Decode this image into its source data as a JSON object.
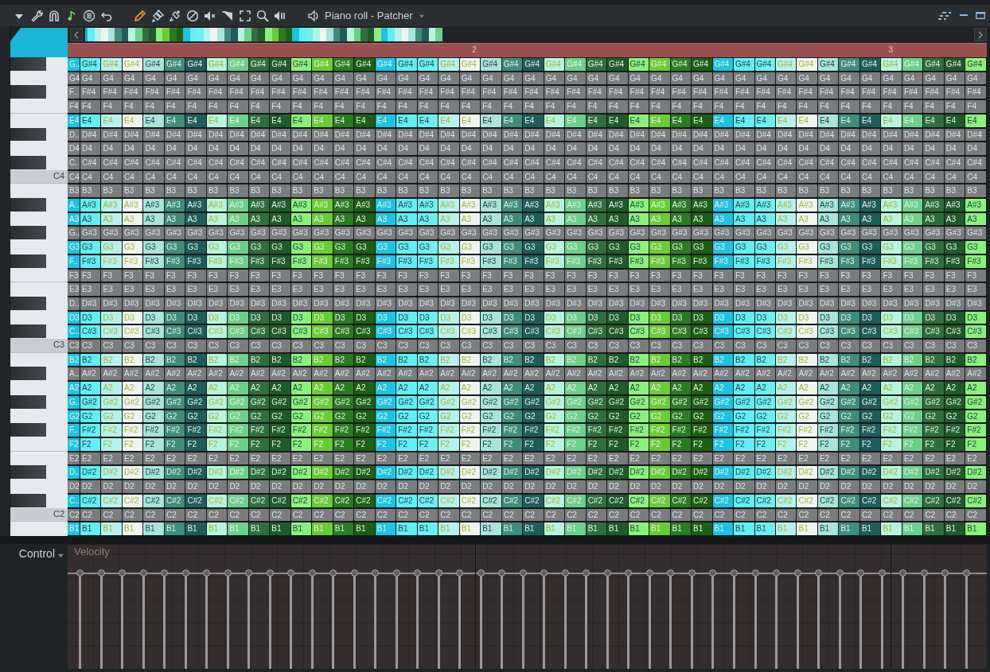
{
  "window": {
    "title": "Piano roll - Patcher"
  },
  "timeline": {
    "markers": [
      {
        "label": "2"
      },
      {
        "label": "3"
      }
    ]
  },
  "columns": [
    {
      "color": "#1cc3e3"
    },
    {
      "color": "#62eef5"
    },
    {
      "color": "#b5f2ee"
    },
    {
      "color": "#eef5f0"
    },
    {
      "color": "#a9e3dc"
    },
    {
      "color": "#3f8c7c"
    },
    {
      "color": "#1f5c5c"
    },
    {
      "color": "#b6f4dd"
    },
    {
      "color": "#6dcf8c"
    },
    {
      "color": "#2f6f3d"
    },
    {
      "color": "#1f5a2b"
    },
    {
      "color": "#8cf07c"
    },
    {
      "color": "#6acc34"
    },
    {
      "color": "#2b7b23"
    },
    {
      "color": "#1d5f15"
    },
    {
      "color": "#1cc3e3"
    },
    {
      "color": "#62eef5"
    },
    {
      "color": "#6ef0f2"
    },
    {
      "color": "#b5f2ee"
    },
    {
      "color": "#eef5f0"
    },
    {
      "color": "#a9e3dc"
    },
    {
      "color": "#3f8c7c"
    },
    {
      "color": "#1f5c5c"
    },
    {
      "color": "#b6f4dd"
    },
    {
      "color": "#6dcf8c"
    },
    {
      "color": "#2f6f3d"
    },
    {
      "color": "#1f5a2b"
    },
    {
      "color": "#8cf07c"
    },
    {
      "color": "#6acc34"
    },
    {
      "color": "#2b7b23"
    },
    {
      "color": "#1d5f15"
    },
    {
      "color": "#1cc3e3"
    },
    {
      "color": "#62eef5"
    },
    {
      "color": "#6ef0f2"
    },
    {
      "color": "#b5f2ee"
    },
    {
      "color": "#eef5f0"
    },
    {
      "color": "#a9e3dc"
    },
    {
      "color": "#3f8c7c"
    },
    {
      "color": "#1f5c5c"
    },
    {
      "color": "#b6f4dd"
    },
    {
      "color": "#6dcf8c"
    },
    {
      "color": "#2f6f3d"
    },
    {
      "color": "#1f5a2b"
    },
    {
      "color": "#8cf07c"
    }
  ],
  "rows": [
    {
      "kind": "black",
      "active": true,
      "labels": [
        "G..",
        "G#4",
        "G#4",
        "G#4",
        "G#4",
        "G#4",
        "G#4",
        "G#4",
        "G#4",
        "G#4",
        "G#4",
        "G#4",
        "G#4",
        "G#4",
        "G#4",
        "G#4",
        "G#4",
        "G#4",
        "G#4",
        "G#4",
        "G#4",
        "G#4",
        "G#4",
        "G#4",
        "G#4",
        "G#4",
        "G#4",
        "G#4",
        "G#4",
        "G#4",
        "G#4",
        "G#4",
        "G#4",
        "G#4",
        "G#4",
        "G#4",
        "G#4",
        "G#4",
        "G#4",
        "G#4",
        "G#4",
        "G#4",
        "G#4",
        "G#4"
      ]
    },
    {
      "kind": "white",
      "active": false,
      "labels": [
        "G4",
        "G4",
        "G4",
        "G4",
        "G4",
        "G4",
        "G4",
        "G4",
        "G4",
        "G4",
        "G4",
        "G4",
        "G4",
        "G4",
        "G4",
        "G4",
        "G4",
        "G4",
        "G4",
        "G4",
        "G4",
        "G4",
        "G4",
        "G4",
        "G4",
        "G4",
        "G4",
        "G4",
        "G4",
        "G4",
        "G4",
        "G4",
        "G4",
        "G4",
        "G4",
        "G4",
        "G4",
        "G4",
        "G4",
        "G4",
        "G4",
        "G4",
        "G4",
        "G4"
      ]
    },
    {
      "kind": "black",
      "active": false,
      "labels": [
        "F..",
        "F#4",
        "F#4",
        "F#4",
        "F#4",
        "F#4",
        "F#4",
        "F#4",
        "F#4",
        "F#4",
        "F#4",
        "F#4",
        "F#4",
        "F#4",
        "F#4",
        "F#4",
        "F#4",
        "F#4",
        "F#4",
        "F#4",
        "F#4",
        "F#4",
        "F#4",
        "F#4",
        "F#4",
        "F#4",
        "F#4",
        "F#4",
        "F#4",
        "F#4",
        "F#4",
        "F#4",
        "F#4",
        "F#4",
        "F#4",
        "F#4",
        "F#4",
        "F#4",
        "F#4",
        "F#4",
        "F#4",
        "F#4",
        "F#4",
        "F#4"
      ]
    },
    {
      "kind": "white",
      "active": false,
      "labels": [
        "F4",
        "F4",
        "F4",
        "F4",
        "F4",
        "F4",
        "F4",
        "F4",
        "F4",
        "F4",
        "F4",
        "F4",
        "F4",
        "F4",
        "F4",
        "F4",
        "F4",
        "F4",
        "F4",
        "F4",
        "F4",
        "F4",
        "F4",
        "F4",
        "F4",
        "F4",
        "F4",
        "F4",
        "F4",
        "F4",
        "F4",
        "F4",
        "F4",
        "F4",
        "F4",
        "F4",
        "F4",
        "F4",
        "F4",
        "F4",
        "F4",
        "F4",
        "F4",
        "F4"
      ]
    },
    {
      "kind": "white",
      "active": true,
      "labels": [
        "E4",
        "E4",
        "E4",
        "E4",
        "E4",
        "E4",
        "E4",
        "E4",
        "E4",
        "E4",
        "E4",
        "E4",
        "E4",
        "E4",
        "E4",
        "E4",
        "E4",
        "E4",
        "E4",
        "E4",
        "E4",
        "E4",
        "E4",
        "E4",
        "E4",
        "E4",
        "E4",
        "E4",
        "E4",
        "E4",
        "E4",
        "E4",
        "E4",
        "E4",
        "E4",
        "E4",
        "E4",
        "E4",
        "E4",
        "E4",
        "E4",
        "E4",
        "E4",
        "E4"
      ]
    },
    {
      "kind": "black",
      "active": false,
      "labels": [
        "D..",
        "D#4",
        "D#4",
        "D#4",
        "D#4",
        "D#4",
        "D#4",
        "D#4",
        "D#4",
        "D#4",
        "D#4",
        "D#4",
        "D#4",
        "D#4",
        "D#4",
        "D#4",
        "D#4",
        "D#4",
        "D#4",
        "D#4",
        "D#4",
        "D#4",
        "D#4",
        "D#4",
        "D#4",
        "D#4",
        "D#4",
        "D#4",
        "D#4",
        "D#4",
        "D#4",
        "D#4",
        "D#4",
        "D#4",
        "D#4",
        "D#4",
        "D#4",
        "D#4",
        "D#4",
        "D#4",
        "D#4",
        "D#4",
        "D#4",
        "D#4"
      ]
    },
    {
      "kind": "white",
      "active": false,
      "labels": [
        "D4",
        "D4",
        "D4",
        "D4",
        "D4",
        "D4",
        "D4",
        "D4",
        "D4",
        "D4",
        "D4",
        "D4",
        "D4",
        "D4",
        "D4",
        "D4",
        "D4",
        "D4",
        "D4",
        "D4",
        "D4",
        "D4",
        "D4",
        "D4",
        "D4",
        "D4",
        "D4",
        "D4",
        "D4",
        "D4",
        "D4",
        "D4",
        "D4",
        "D4",
        "D4",
        "D4",
        "D4",
        "D4",
        "D4",
        "D4",
        "D4",
        "D4",
        "D4",
        "D4"
      ]
    },
    {
      "kind": "black",
      "active": false,
      "labels": [
        "C..",
        "C#4",
        "C#4",
        "C#4",
        "C#4",
        "C#4",
        "C#4",
        "C#4",
        "C#4",
        "C#4",
        "C#4",
        "C#4",
        "C#4",
        "C#4",
        "C#4",
        "C#4",
        "C#4",
        "C#4",
        "C#4",
        "C#4",
        "C#4",
        "C#4",
        "C#4",
        "C#4",
        "C#4",
        "C#4",
        "C#4",
        "C#4",
        "C#4",
        "C#4",
        "C#4",
        "C#4",
        "C#4",
        "C#4",
        "C#4",
        "C#4",
        "C#4",
        "C#4",
        "C#4",
        "C#4",
        "C#4",
        "C#4",
        "C#4",
        "C#4"
      ]
    },
    {
      "kind": "white",
      "active": false,
      "key_label": "C4",
      "labels": [
        "C4",
        "C4",
        "C4",
        "C4",
        "C4",
        "C4",
        "C4",
        "C4",
        "C4",
        "C4",
        "C4",
        "C4",
        "C4",
        "C4",
        "C4",
        "C4",
        "C4",
        "C4",
        "C4",
        "C4",
        "C4",
        "C4",
        "C4",
        "C4",
        "C4",
        "C4",
        "C4",
        "C4",
        "C4",
        "C4",
        "C4",
        "C4",
        "C4",
        "C4",
        "C4",
        "C4",
        "C4",
        "C4",
        "C4",
        "C4",
        "C4",
        "C4",
        "C4",
        "C4"
      ]
    },
    {
      "kind": "white",
      "active": false,
      "labels": [
        "B3",
        "B3",
        "B3",
        "B3",
        "B3",
        "B3",
        "B3",
        "B3",
        "B3",
        "B3",
        "B3",
        "B3",
        "B3",
        "B3",
        "B3",
        "B3",
        "B3",
        "B3",
        "B3",
        "B3",
        "B3",
        "B3",
        "B3",
        "B3",
        "B3",
        "B3",
        "B3",
        "B3",
        "B3",
        "B3",
        "B3",
        "B3",
        "B3",
        "B3",
        "B3",
        "B3",
        "B3",
        "B3",
        "B3",
        "B3",
        "B3",
        "B3",
        "B3",
        "B3"
      ]
    },
    {
      "kind": "black",
      "active": true,
      "labels": [
        "A..",
        "A#3",
        "A#3",
        "A#3",
        "A#3",
        "A#3",
        "A#3",
        "A#3",
        "A#3",
        "A#3",
        "A#3",
        "A#3",
        "A#3",
        "A#3",
        "A#3",
        "A#3",
        "A#3",
        "A#3",
        "A#3",
        "A#3",
        "A#3",
        "A#3",
        "A#3",
        "A#3",
        "A#3",
        "A#3",
        "A#3",
        "A#3",
        "A#3",
        "A#3",
        "A#3",
        "A#3",
        "A#3",
        "A#3",
        "A#3",
        "A#3",
        "A#3",
        "A#3",
        "A#3",
        "A#3",
        "A#3",
        "A#3",
        "A#3",
        "A#3"
      ]
    },
    {
      "kind": "white",
      "active": true,
      "labels": [
        "A3",
        "A3",
        "A3",
        "A3",
        "A3",
        "A3",
        "A3",
        "A3",
        "A3",
        "A3",
        "A3",
        "A3",
        "A3",
        "A3",
        "A3",
        "A3",
        "A3",
        "A3",
        "A3",
        "A3",
        "A3",
        "A3",
        "A3",
        "A3",
        "A3",
        "A3",
        "A3",
        "A3",
        "A3",
        "A3",
        "A3",
        "A3",
        "A3",
        "A3",
        "A3",
        "A3",
        "A3",
        "A3",
        "A3",
        "A3",
        "A3",
        "A3",
        "A3",
        "A3"
      ]
    },
    {
      "kind": "black",
      "active": false,
      "labels": [
        "G..",
        "G#3",
        "G#3",
        "G#3",
        "G#3",
        "G#3",
        "G#3",
        "G#3",
        "G#3",
        "G#3",
        "G#3",
        "G#3",
        "G#3",
        "G#3",
        "G#3",
        "G#3",
        "G#3",
        "G#3",
        "G#3",
        "G#3",
        "G#3",
        "G#3",
        "G#3",
        "G#3",
        "G#3",
        "G#3",
        "G#3",
        "G#3",
        "G#3",
        "G#3",
        "G#3",
        "G#3",
        "G#3",
        "G#3",
        "G#3",
        "G#3",
        "G#3",
        "G#3",
        "G#3",
        "G#3",
        "G#3",
        "G#3",
        "G#3",
        "G#3"
      ]
    },
    {
      "kind": "white",
      "active": true,
      "labels": [
        "G3",
        "G3",
        "G3",
        "G3",
        "G3",
        "G3",
        "G3",
        "G3",
        "G3",
        "G3",
        "G3",
        "G3",
        "G3",
        "G3",
        "G3",
        "G3",
        "G3",
        "G3",
        "G3",
        "G3",
        "G3",
        "G3",
        "G3",
        "G3",
        "G3",
        "G3",
        "G3",
        "G3",
        "G3",
        "G3",
        "G3",
        "G3",
        "G3",
        "G3",
        "G3",
        "G3",
        "G3",
        "G3",
        "G3",
        "G3",
        "G3",
        "G3",
        "G3",
        "G3"
      ]
    },
    {
      "kind": "black",
      "active": true,
      "labels": [
        "F..",
        "F#3",
        "F#3",
        "F#3",
        "F#3",
        "F#3",
        "F#3",
        "F#3",
        "F#3",
        "F#3",
        "F#3",
        "F#3",
        "F#3",
        "F#3",
        "F#3",
        "F#3",
        "F#3",
        "F#3",
        "F#3",
        "F#3",
        "F#3",
        "F#3",
        "F#3",
        "F#3",
        "F#3",
        "F#3",
        "F#3",
        "F#3",
        "F#3",
        "F#3",
        "F#3",
        "F#3",
        "F#3",
        "F#3",
        "F#3",
        "F#3",
        "F#3",
        "F#3",
        "F#3",
        "F#3",
        "F#3",
        "F#3",
        "F#3",
        "F#3"
      ]
    },
    {
      "kind": "white",
      "active": false,
      "labels": [
        "F3",
        "F3",
        "F3",
        "F3",
        "F3",
        "F3",
        "F3",
        "F3",
        "F3",
        "F3",
        "F3",
        "F3",
        "F3",
        "F3",
        "F3",
        "F3",
        "F3",
        "F3",
        "F3",
        "F3",
        "F3",
        "F3",
        "F3",
        "F3",
        "F3",
        "F3",
        "F3",
        "F3",
        "F3",
        "F3",
        "F3",
        "F3",
        "F3",
        "F3",
        "F3",
        "F3",
        "F3",
        "F3",
        "F3",
        "F3",
        "F3",
        "F3",
        "F3",
        "F3"
      ]
    },
    {
      "kind": "white",
      "active": false,
      "labels": [
        "E3",
        "E3",
        "E3",
        "E3",
        "E3",
        "E3",
        "E3",
        "E3",
        "E3",
        "E3",
        "E3",
        "E3",
        "E3",
        "E3",
        "E3",
        "E3",
        "E3",
        "E3",
        "E3",
        "E3",
        "E3",
        "E3",
        "E3",
        "E3",
        "E3",
        "E3",
        "E3",
        "E3",
        "E3",
        "E3",
        "E3",
        "E3",
        "E3",
        "E3",
        "E3",
        "E3",
        "E3",
        "E3",
        "E3",
        "E3",
        "E3",
        "E3",
        "E3",
        "E3"
      ]
    },
    {
      "kind": "black",
      "active": false,
      "labels": [
        "D..",
        "D#3",
        "D#3",
        "D#3",
        "D#3",
        "D#3",
        "D#3",
        "D#3",
        "D#3",
        "D#3",
        "D#3",
        "D#3",
        "D#3",
        "D#3",
        "D#3",
        "D#3",
        "D#3",
        "D#3",
        "D#3",
        "D#3",
        "D#3",
        "D#3",
        "D#3",
        "D#3",
        "D#3",
        "D#3",
        "D#3",
        "D#3",
        "D#3",
        "D#3",
        "D#3",
        "D#3",
        "D#3",
        "D#3",
        "D#3",
        "D#3",
        "D#3",
        "D#3",
        "D#3",
        "D#3",
        "D#3",
        "D#3",
        "D#3",
        "D#3"
      ]
    },
    {
      "kind": "white",
      "active": true,
      "labels": [
        "D3",
        "D3",
        "D3",
        "D3",
        "D3",
        "D3",
        "D3",
        "D3",
        "D3",
        "D3",
        "D3",
        "D3",
        "D3",
        "D3",
        "D3",
        "D3",
        "D3",
        "D3",
        "D3",
        "D3",
        "D3",
        "D3",
        "D3",
        "D3",
        "D3",
        "D3",
        "D3",
        "D3",
        "D3",
        "D3",
        "D3",
        "D3",
        "D3",
        "D3",
        "D3",
        "D3",
        "D3",
        "D3",
        "D3",
        "D3",
        "D3",
        "D3",
        "D3",
        "D3"
      ]
    },
    {
      "kind": "black",
      "active": true,
      "labels": [
        "C..",
        "C#3",
        "C#3",
        "C#3",
        "C#3",
        "C#3",
        "C#3",
        "C#3",
        "C#3",
        "C#3",
        "C#3",
        "C#3",
        "C#3",
        "C#3",
        "C#3",
        "C#3",
        "C#3",
        "C#3",
        "C#3",
        "C#3",
        "C#3",
        "C#3",
        "C#3",
        "C#3",
        "C#3",
        "C#3",
        "C#3",
        "C#3",
        "C#3",
        "C#3",
        "C#3",
        "C#3",
        "C#3",
        "C#3",
        "C#3",
        "C#3",
        "C#3",
        "C#3",
        "C#3",
        "C#3",
        "C#3",
        "C#3",
        "C#3",
        "C#3"
      ]
    },
    {
      "kind": "white",
      "active": false,
      "key_label": "C3",
      "labels": [
        "C3",
        "C3",
        "C3",
        "C3",
        "C3",
        "C3",
        "C3",
        "C3",
        "C3",
        "C3",
        "C3",
        "C3",
        "C3",
        "C3",
        "C3",
        "C3",
        "C3",
        "C3",
        "C3",
        "C3",
        "C3",
        "C3",
        "C3",
        "C3",
        "C3",
        "C3",
        "C3",
        "C3",
        "C3",
        "C3",
        "C3",
        "C3",
        "C3",
        "C3",
        "C3",
        "C3",
        "C3",
        "C3",
        "C3",
        "C3",
        "C3",
        "C3",
        "C3",
        "C3"
      ]
    },
    {
      "kind": "white",
      "active": true,
      "labels": [
        "B2",
        "B2",
        "B2",
        "B2",
        "B2",
        "B2",
        "B2",
        "B2",
        "B2",
        "B2",
        "B2",
        "B2",
        "B2",
        "B2",
        "B2",
        "B2",
        "B2",
        "B2",
        "B2",
        "B2",
        "B2",
        "B2",
        "B2",
        "B2",
        "B2",
        "B2",
        "B2",
        "B2",
        "B2",
        "B2",
        "B2",
        "B2",
        "B2",
        "B2",
        "B2",
        "B2",
        "B2",
        "B2",
        "B2",
        "B2",
        "B2",
        "B2",
        "B2",
        "B2"
      ]
    },
    {
      "kind": "black",
      "active": false,
      "labels": [
        "A..",
        "A#2",
        "A#2",
        "A#2",
        "A#2",
        "A#2",
        "A#2",
        "A#2",
        "A#2",
        "A#2",
        "A#2",
        "A#2",
        "A#2",
        "A#2",
        "A#2",
        "A#2",
        "A#2",
        "A#2",
        "A#2",
        "A#2",
        "A#2",
        "A#2",
        "A#2",
        "A#2",
        "A#2",
        "A#2",
        "A#2",
        "A#2",
        "A#2",
        "A#2",
        "A#2",
        "A#2",
        "A#2",
        "A#2",
        "A#2",
        "A#2",
        "A#2",
        "A#2",
        "A#2",
        "A#2",
        "A#2",
        "A#2",
        "A#2",
        "A#2"
      ]
    },
    {
      "kind": "white",
      "active": true,
      "labels": [
        "A2",
        "A2",
        "A2",
        "A2",
        "A2",
        "A2",
        "A2",
        "A2",
        "A2",
        "A2",
        "A2",
        "A2",
        "A2",
        "A2",
        "A2",
        "A2",
        "A2",
        "A2",
        "A2",
        "A2",
        "A2",
        "A2",
        "A2",
        "A2",
        "A2",
        "A2",
        "A2",
        "A2",
        "A2",
        "A2",
        "A2",
        "A2",
        "A2",
        "A2",
        "A2",
        "A2",
        "A2",
        "A2",
        "A2",
        "A2",
        "A2",
        "A2",
        "A2",
        "A2"
      ]
    },
    {
      "kind": "black",
      "active": true,
      "labels": [
        "G..",
        "G#2",
        "G#2",
        "G#2",
        "G#2",
        "G#2",
        "G#2",
        "G#2",
        "G#2",
        "G#2",
        "G#2",
        "G#2",
        "G#2",
        "G#2",
        "G#2",
        "G#2",
        "G#2",
        "G#2",
        "G#2",
        "G#2",
        "G#2",
        "G#2",
        "G#2",
        "G#2",
        "G#2",
        "G#2",
        "G#2",
        "G#2",
        "G#2",
        "G#2",
        "G#2",
        "G#2",
        "G#2",
        "G#2",
        "G#2",
        "G#2",
        "G#2",
        "G#2",
        "G#2",
        "G#2",
        "G#2",
        "G#2",
        "G#2",
        "G#2"
      ]
    },
    {
      "kind": "white",
      "active": true,
      "labels": [
        "G2",
        "G2",
        "G2",
        "G2",
        "G2",
        "G2",
        "G2",
        "G2",
        "G2",
        "G2",
        "G2",
        "G2",
        "G2",
        "G2",
        "G2",
        "G2",
        "G2",
        "G2",
        "G2",
        "G2",
        "G2",
        "G2",
        "G2",
        "G2",
        "G2",
        "G2",
        "G2",
        "G2",
        "G2",
        "G2",
        "G2",
        "G2",
        "G2",
        "G2",
        "G2",
        "G2",
        "G2",
        "G2",
        "G2",
        "G2",
        "G2",
        "G2",
        "G2",
        "G2"
      ]
    },
    {
      "kind": "black",
      "active": true,
      "labels": [
        "F..",
        "F#2",
        "F#2",
        "F#2",
        "F#2",
        "F#2",
        "F#2",
        "F#2",
        "F#2",
        "F#2",
        "F#2",
        "F#2",
        "F#2",
        "F#2",
        "F#2",
        "F#2",
        "F#2",
        "F#2",
        "F#2",
        "F#2",
        "F#2",
        "F#2",
        "F#2",
        "F#2",
        "F#2",
        "F#2",
        "F#2",
        "F#2",
        "F#2",
        "F#2",
        "F#2",
        "F#2",
        "F#2",
        "F#2",
        "F#2",
        "F#2",
        "F#2",
        "F#2",
        "F#2",
        "F#2",
        "F#2",
        "F#2",
        "F#2",
        "F#2"
      ]
    },
    {
      "kind": "white",
      "active": true,
      "labels": [
        "F2",
        "F2",
        "F2",
        "F2",
        "F2",
        "F2",
        "F2",
        "F2",
        "F2",
        "F2",
        "F2",
        "F2",
        "F2",
        "F2",
        "F2",
        "F2",
        "F2",
        "F2",
        "F2",
        "F2",
        "F2",
        "F2",
        "F2",
        "F2",
        "F2",
        "F2",
        "F2",
        "F2",
        "F2",
        "F2",
        "F2",
        "F2",
        "F2",
        "F2",
        "F2",
        "F2",
        "F2",
        "F2",
        "F2",
        "F2",
        "F2",
        "F2",
        "F2",
        "F2"
      ]
    },
    {
      "kind": "white",
      "active": false,
      "labels": [
        "E2",
        "E2",
        "E2",
        "E2",
        "E2",
        "E2",
        "E2",
        "E2",
        "E2",
        "E2",
        "E2",
        "E2",
        "E2",
        "E2",
        "E2",
        "E2",
        "E2",
        "E2",
        "E2",
        "E2",
        "E2",
        "E2",
        "E2",
        "E2",
        "E2",
        "E2",
        "E2",
        "E2",
        "E2",
        "E2",
        "E2",
        "E2",
        "E2",
        "E2",
        "E2",
        "E2",
        "E2",
        "E2",
        "E2",
        "E2",
        "E2",
        "E2",
        "E2",
        "E2"
      ]
    },
    {
      "kind": "black",
      "active": true,
      "labels": [
        "D..",
        "D#2",
        "D#2",
        "D#2",
        "D#2",
        "D#2",
        "D#2",
        "D#2",
        "D#2",
        "D#2",
        "D#2",
        "D#2",
        "D#2",
        "D#2",
        "D#2",
        "D#2",
        "D#2",
        "D#2",
        "D#2",
        "D#2",
        "D#2",
        "D#2",
        "D#2",
        "D#2",
        "D#2",
        "D#2",
        "D#2",
        "D#2",
        "D#2",
        "D#2",
        "D#2",
        "D#2",
        "D#2",
        "D#2",
        "D#2",
        "D#2",
        "D#2",
        "D#2",
        "D#2",
        "D#2",
        "D#2",
        "D#2",
        "D#2",
        "D#2"
      ]
    },
    {
      "kind": "white",
      "active": false,
      "labels": [
        "D2",
        "D2",
        "D2",
        "D2",
        "D2",
        "D2",
        "D2",
        "D2",
        "D2",
        "D2",
        "D2",
        "D2",
        "D2",
        "D2",
        "D2",
        "D2",
        "D2",
        "D2",
        "D2",
        "D2",
        "D2",
        "D2",
        "D2",
        "D2",
        "D2",
        "D2",
        "D2",
        "D2",
        "D2",
        "D2",
        "D2",
        "D2",
        "D2",
        "D2",
        "D2",
        "D2",
        "D2",
        "D2",
        "D2",
        "D2",
        "D2",
        "D2",
        "D2",
        "D2"
      ]
    },
    {
      "kind": "black",
      "active": true,
      "labels": [
        "C..",
        "C#2",
        "C#2",
        "C#2",
        "C#2",
        "C#2",
        "C#2",
        "C#2",
        "C#2",
        "C#2",
        "C#2",
        "C#2",
        "C#2",
        "C#2",
        "C#2",
        "C#2",
        "C#2",
        "C#2",
        "C#2",
        "C#2",
        "C#2",
        "C#2",
        "C#2",
        "C#2",
        "C#2",
        "C#2",
        "C#2",
        "C#2",
        "C#2",
        "C#2",
        "C#2",
        "C#2",
        "C#2",
        "C#2",
        "C#2",
        "C#2",
        "C#2",
        "C#2",
        "C#2",
        "C#2",
        "C#2",
        "C#2",
        "C#2",
        "C#2"
      ]
    },
    {
      "kind": "white",
      "active": false,
      "key_label": "C2",
      "labels": [
        "C2",
        "C2",
        "C2",
        "C2",
        "C2",
        "C2",
        "C2",
        "C2",
        "C2",
        "C2",
        "C2",
        "C2",
        "C2",
        "C2",
        "C2",
        "C2",
        "C2",
        "C2",
        "C2",
        "C2",
        "C2",
        "C2",
        "C2",
        "C2",
        "C2",
        "C2",
        "C2",
        "C2",
        "C2",
        "C2",
        "C2",
        "C2",
        "C2",
        "C2",
        "C2",
        "C2",
        "C2",
        "C2",
        "C2",
        "C2",
        "C2",
        "C2",
        "C2",
        "C2"
      ]
    },
    {
      "kind": "white",
      "active": true,
      "labels": [
        "B1",
        "B1",
        "B1",
        "B1",
        "B1",
        "B1",
        "B1",
        "B1",
        "B1",
        "B1",
        "B1",
        "B1",
        "B1",
        "B1",
        "B1",
        "B1",
        "B1",
        "B1",
        "B1",
        "B1",
        "B1",
        "B1",
        "B1",
        "B1",
        "B1",
        "B1",
        "B1",
        "B1",
        "B1",
        "B1",
        "B1",
        "B1",
        "B1",
        "B1",
        "B1",
        "B1",
        "B1",
        "B1",
        "B1",
        "B1",
        "B1",
        "B1",
        "B1",
        "B1"
      ]
    }
  ],
  "control": {
    "label": "Control",
    "lane_label": "Velocity"
  }
}
